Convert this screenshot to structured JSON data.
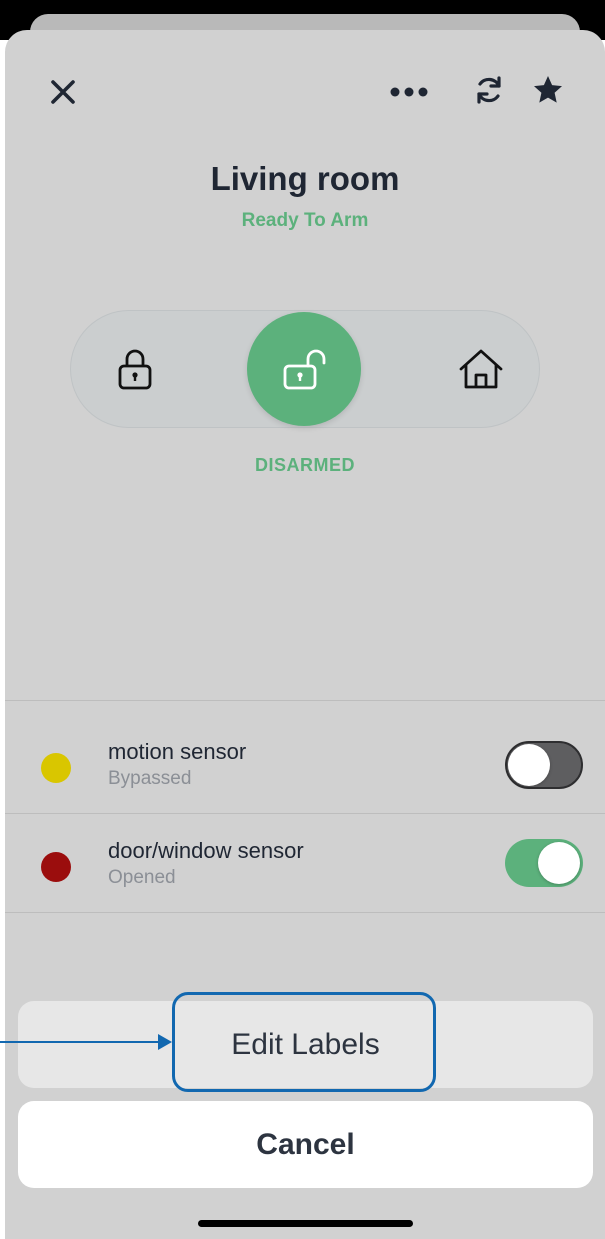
{
  "header": {
    "close_icon": "close-icon",
    "more_icon": "more-icon",
    "refresh_icon": "refresh-icon",
    "favorite_icon": "star-icon"
  },
  "room": {
    "title": "Living room",
    "status": "Ready To Arm"
  },
  "arm_modes": {
    "options": [
      "arm-away-lock-icon",
      "disarm-unlock-icon",
      "arm-home-icon"
    ],
    "selected": "disarm-unlock-icon",
    "state_label": "DISARMED",
    "accent_color": "#5cb17c"
  },
  "sensors": [
    {
      "name": "motion sensor",
      "status": "Bypassed",
      "dot_color": "#d9c600",
      "toggle_on": false
    },
    {
      "name": "door/window sensor",
      "status": "Opened",
      "dot_color": "#9b0d0d",
      "toggle_on": true
    }
  ],
  "action_sheet": {
    "edit_label": "Edit Labels",
    "cancel_label": "Cancel"
  },
  "annotation": {
    "color": "#1268b0"
  }
}
